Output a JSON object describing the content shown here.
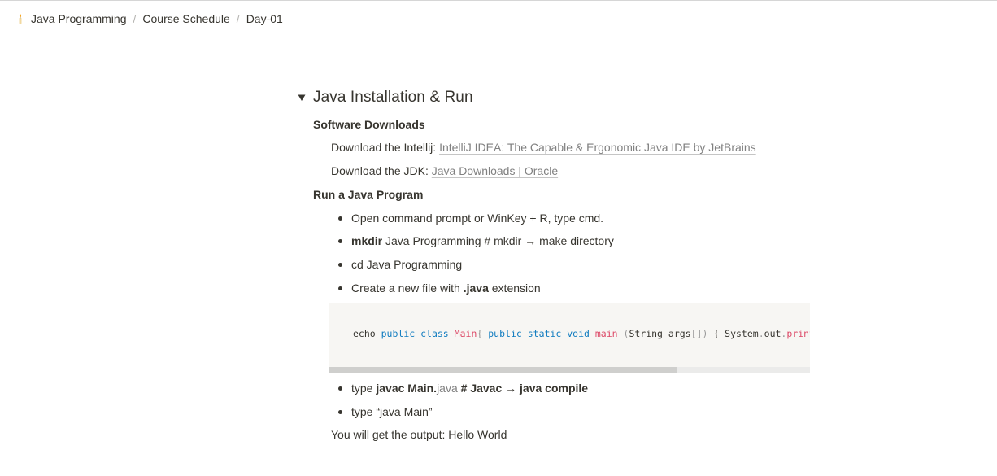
{
  "breadcrumb": [
    {
      "label": "Java Programming",
      "icon": "candle-icon"
    },
    {
      "label": "Course Schedule"
    },
    {
      "label": "Day-01"
    }
  ],
  "breadcrumb_sep": "/",
  "toggle": {
    "title": "Java Installation & Run",
    "expanded": true
  },
  "section1": {
    "heading": "Software Downloads"
  },
  "download_intellij": {
    "prefix": "Download the Intellij: ",
    "link": "IntelliJ IDEA: The Capable & Ergonomic Java IDE by JetBrains"
  },
  "download_jdk": {
    "prefix": "Download the JDK: ",
    "link": "Java Downloads | Oracle"
  },
  "section2": {
    "heading": "Run a Java Program"
  },
  "bullets": {
    "b1": "Open command prompt or WinKey + R, type cmd.",
    "b2_bold": "mkdir",
    "b2_rest": " Java Programming # mkdir → make directory",
    "b3": "cd Java Programming",
    "b4_pre": "Create a new file with ",
    "b4_bold": ".java",
    "b4_post": " extension",
    "b5_pre": " type ",
    "b5_bold1": "javac Main.",
    "b5_link": "java",
    "b5_bold2": " # Javac → java compile",
    "b6": "type “java Main”"
  },
  "code": {
    "t1": "echo ",
    "t2": "public",
    "t3": " ",
    "t4": "class",
    "t5": " ",
    "t6": "Main",
    "t7": "{",
    "t8": " ",
    "t9": "public",
    "t10": " ",
    "t11": "static",
    "t12": " ",
    "t13": "void",
    "t14": " ",
    "t15": "main",
    "t16": " ",
    "t17": "(",
    "t18": "String args",
    "t19": "[])",
    "t20": " { System",
    "t21": ".",
    "t22": "out",
    "t23": ".",
    "t24": "println"
  },
  "output_text": "You will get the output: Hello World",
  "colors": {
    "text": "#37352f",
    "keyword": "#0f7bbf",
    "class_name": "#dd4a68",
    "code_bg": "#f7f6f3",
    "link": "#808080"
  }
}
